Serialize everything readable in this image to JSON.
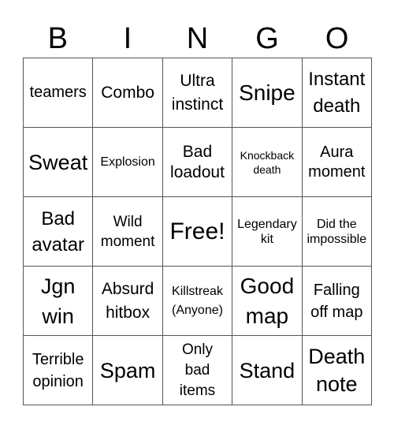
{
  "header": {
    "letters": [
      "B",
      "I",
      "N",
      "G",
      "O"
    ]
  },
  "board": {
    "cells": [
      "teamers",
      "Combo",
      "Ultra instinct",
      "Snipe",
      "Instant death",
      "Sweat",
      "Explosion",
      "Bad loadout",
      "Knockback death",
      "Aura moment",
      "Bad avatar",
      "Wild moment",
      "Free!",
      "Legendary kit",
      "Did the impossible",
      "Jgn win",
      "Absurd hitbox",
      "Killstreak (Anyone)",
      "Good map",
      "Falling off map",
      "Terrible opinion",
      "Spam",
      "Only bad items",
      "Stand",
      "Death note"
    ]
  }
}
